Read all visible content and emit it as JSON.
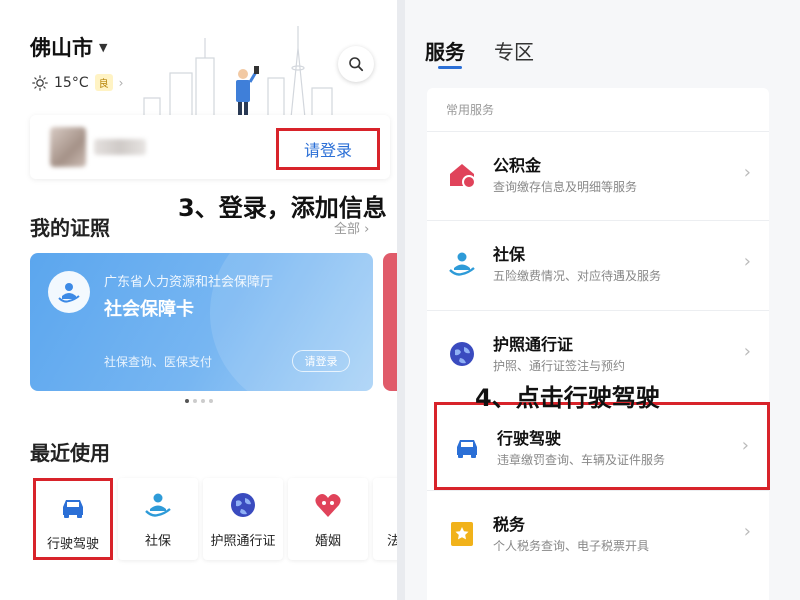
{
  "left": {
    "city": "佛山市",
    "weather": {
      "temp": "15°C",
      "aqi": "良"
    },
    "login_button": "请登录",
    "certs": {
      "title": "我的证照",
      "all_link": "全部",
      "card": {
        "org": "广东省人力资源和社会保障厅",
        "name": "社会保障卡",
        "desc": "社保查询、医保支付",
        "login": "请登录"
      }
    },
    "recent": {
      "title": "最近使用",
      "items": [
        {
          "label": "行驶驾驶",
          "icon": "car-icon"
        },
        {
          "label": "社保",
          "icon": "social-security-icon"
        },
        {
          "label": "护照通行证",
          "icon": "passport-icon"
        },
        {
          "label": "婚姻",
          "icon": "marriage-icon"
        },
        {
          "label": "法",
          "icon": "law-icon"
        }
      ]
    }
  },
  "annotations": {
    "step3": "3、登录，添加信息",
    "step4": "4、点击行驶驾驶"
  },
  "right": {
    "tabs": [
      "服务",
      "专区"
    ],
    "section_header": "常用服务",
    "services": [
      {
        "name": "公积金",
        "desc": "查询缴存信息及明细等服务",
        "icon": "housing-fund-icon"
      },
      {
        "name": "社保",
        "desc": "五险缴费情况、对应待遇及服务",
        "icon": "social-security-icon"
      },
      {
        "name": "护照通行证",
        "desc": "护照、通行证签注与预约",
        "icon": "passport-icon"
      },
      {
        "name": "行驶驾驶",
        "desc": "违章缴罚查询、车辆及证件服务",
        "icon": "car-icon"
      },
      {
        "name": "税务",
        "desc": "个人税务查询、电子税票开具",
        "icon": "tax-icon"
      }
    ]
  },
  "colors": {
    "accent_blue": "#2b6fd6",
    "highlight_red": "#d8232a"
  }
}
